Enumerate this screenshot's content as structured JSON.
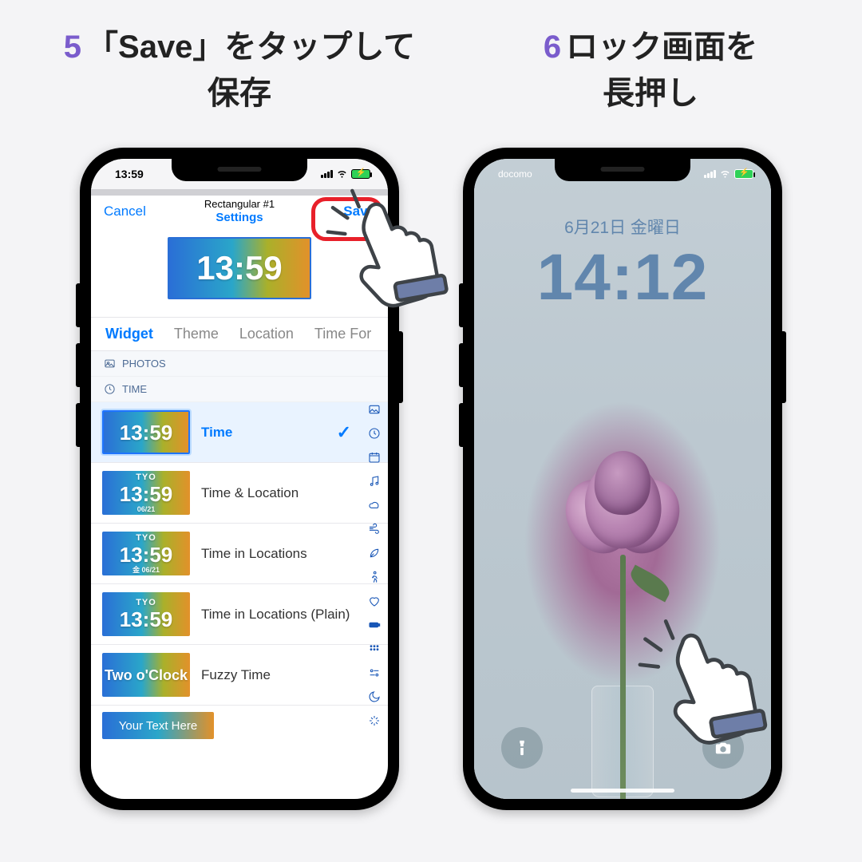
{
  "step5": {
    "num": "5",
    "line1": "「Save」をタップして",
    "line2": "保存"
  },
  "step6": {
    "num": "6",
    "line1": "ロック画面を",
    "line2": "長押し"
  },
  "left": {
    "status_time": "13:59",
    "nav": {
      "cancel": "Cancel",
      "title": "Rectangular #1",
      "subtitle": "Settings",
      "save": "Save"
    },
    "preview_time": "13:59",
    "tabs": [
      "Widget",
      "Theme",
      "Location",
      "Time For"
    ],
    "sections": {
      "photos": "PHOTOS",
      "time": "TIME"
    },
    "options": [
      {
        "thumb_time": "13:59",
        "label": "Time",
        "selected": true
      },
      {
        "tyo": "TYO",
        "thumb_time": "13:59",
        "date": "06/21",
        "label": "Time & Location"
      },
      {
        "tyo": "TYO",
        "thumb_time": "13:59",
        "day": "金",
        "date": "06/21",
        "label": "Time in Locations"
      },
      {
        "tyo": "TYO",
        "thumb_time": "13:59",
        "label": "Time in Locations (Plain)"
      },
      {
        "fuzzy": "Two o'Clock",
        "label": "Fuzzy Time"
      }
    ],
    "peek_text": "Your Text Here"
  },
  "right": {
    "carrier": "docomo",
    "lock_date": "6月21日 金曜日",
    "lock_time": "14:12"
  }
}
